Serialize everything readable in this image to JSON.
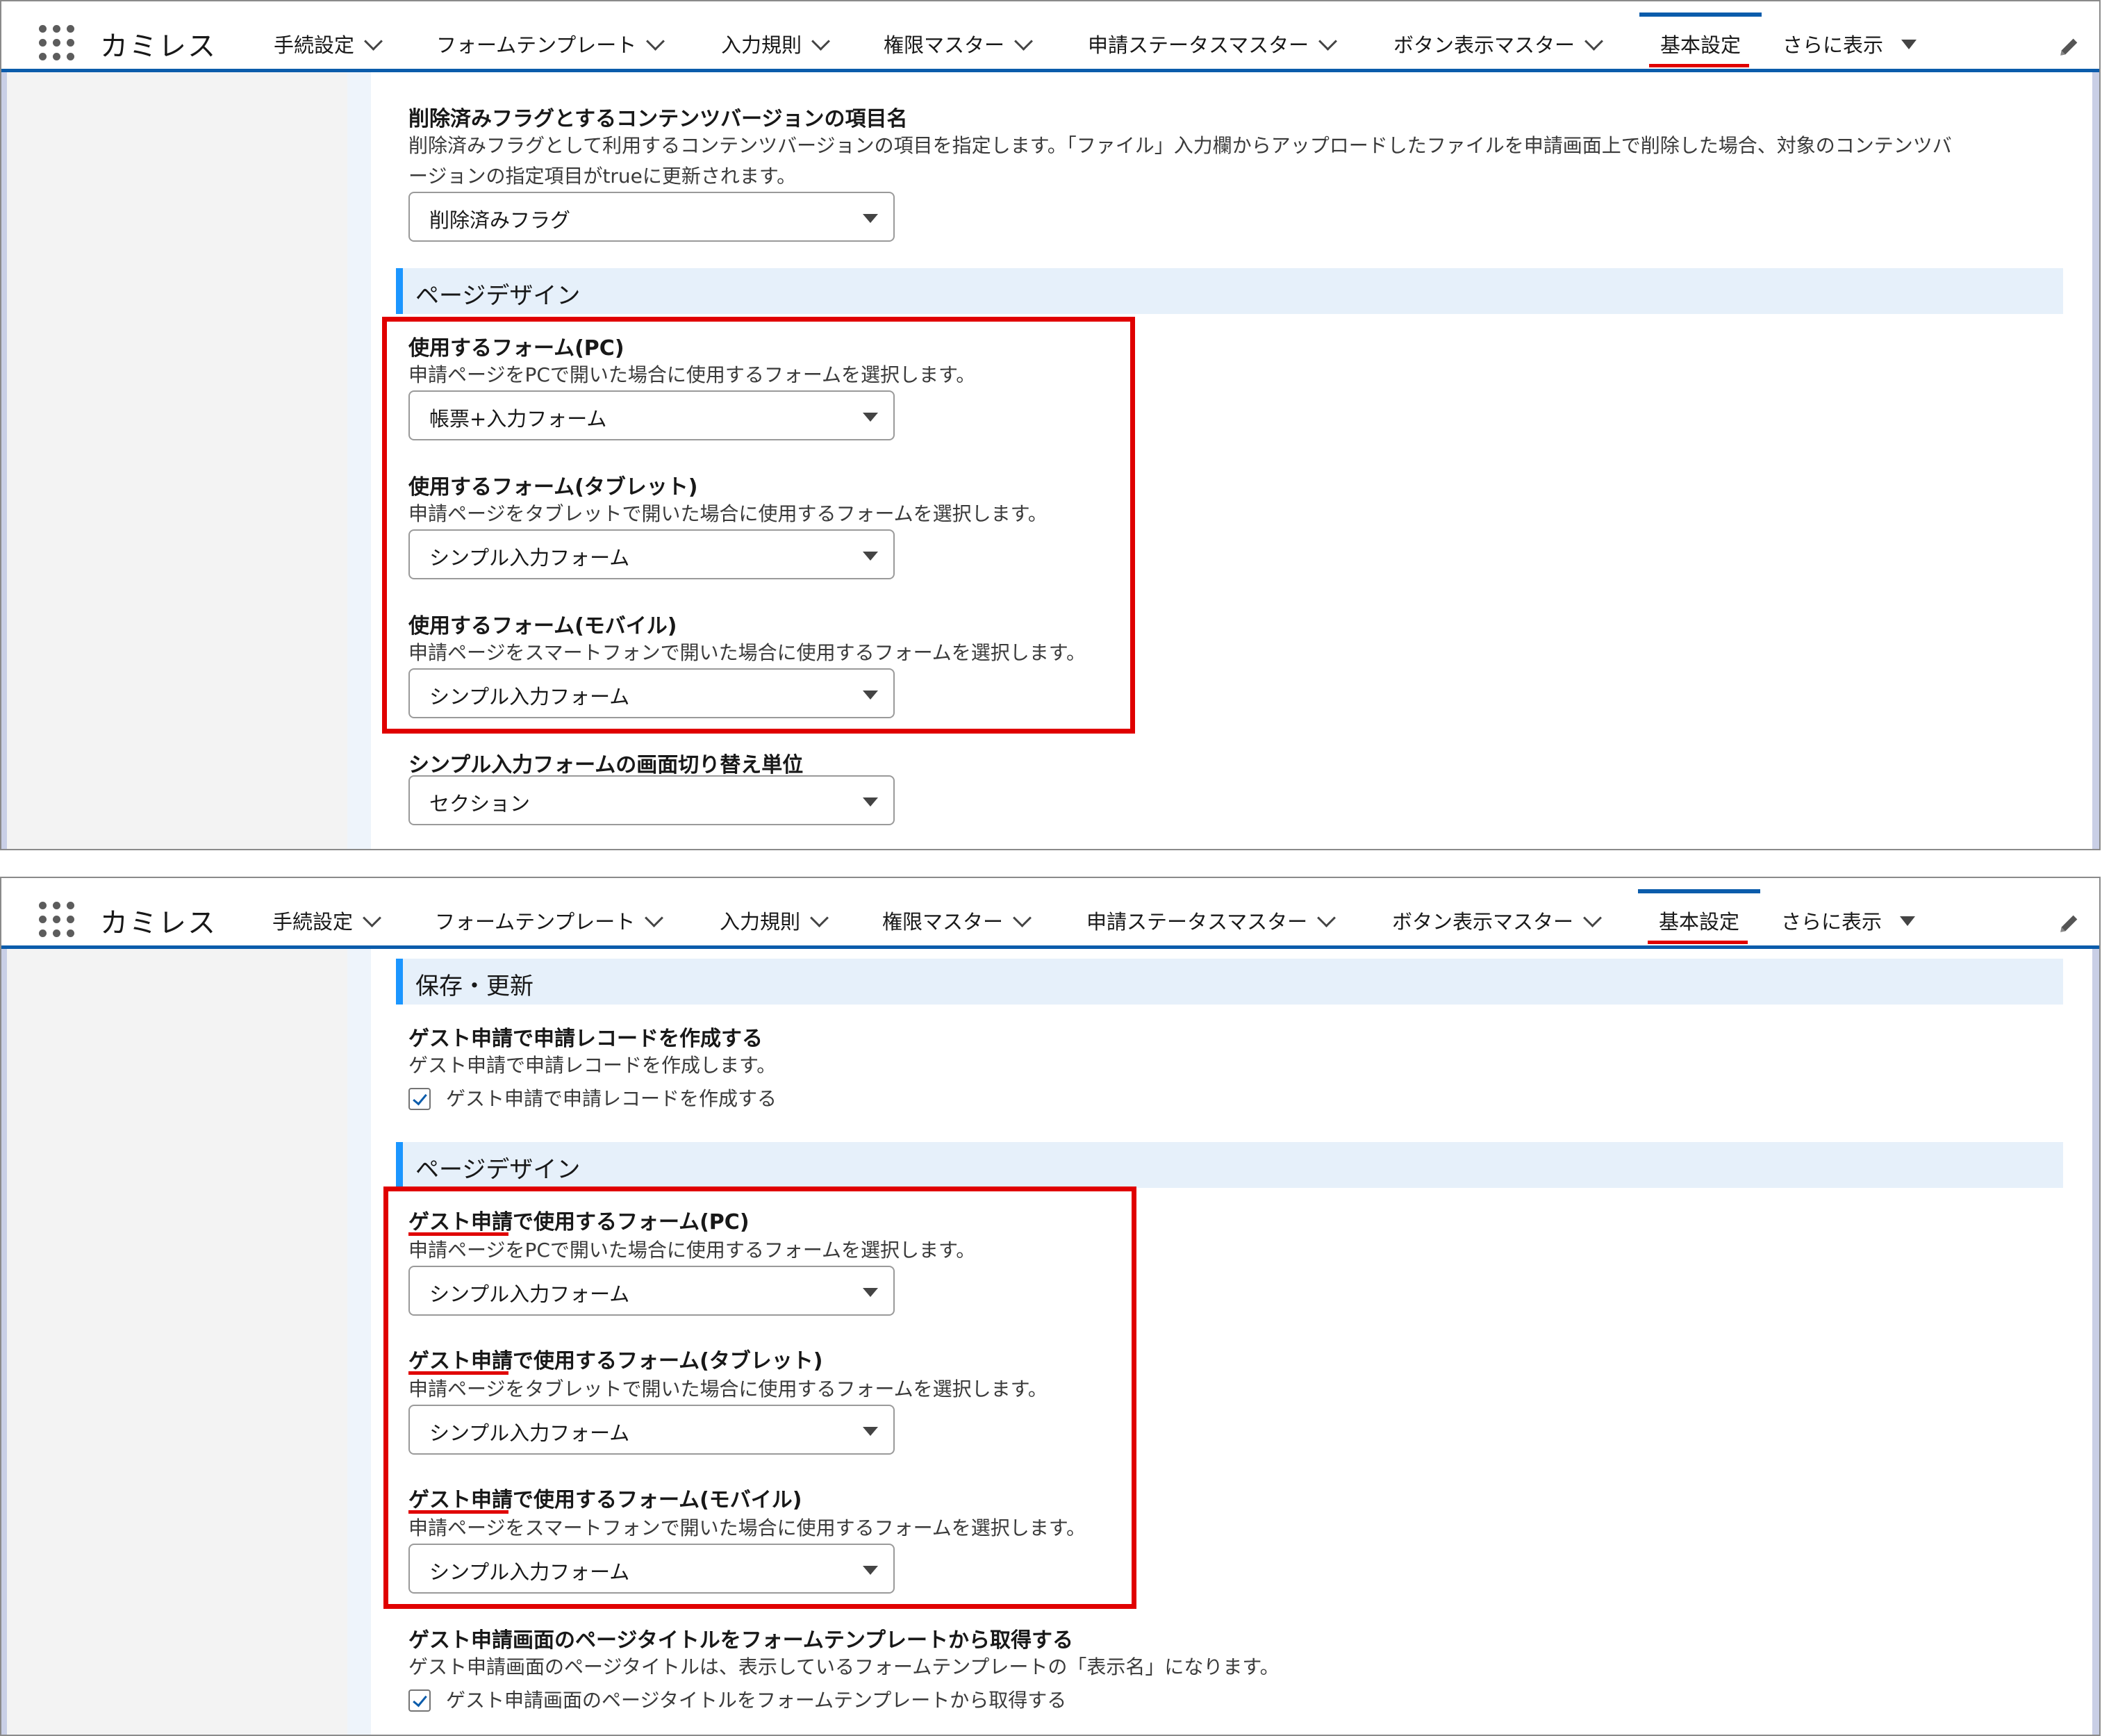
{
  "nav": {
    "app_name": "カミレス",
    "items": [
      {
        "label": "手続設定"
      },
      {
        "label": "フォームテンプレート"
      },
      {
        "label": "入力規則"
      },
      {
        "label": "権限マスター"
      },
      {
        "label": "申請ステータスマスター"
      },
      {
        "label": "ボタン表示マスター"
      },
      {
        "label": "基本設定",
        "active": true
      },
      {
        "label": "さらに表示"
      }
    ]
  },
  "top_panel": {
    "deleted_flag": {
      "label": "削除済みフラグとするコンテンツバージョンの項目名",
      "help_line1": "削除済みフラグとして利用するコンテンツバージョンの項目を指定します。「ファイル」入力欄からアップロードしたファイルを申請画面上で削除した場合、対象のコンテンツバ",
      "help_line2": "ージョンの指定項目がtrueに更新されます。",
      "value": "削除済みフラグ"
    },
    "section_title": "ページデザイン",
    "form_pc": {
      "label": "使用するフォーム(PC)",
      "help": "申請ページをPCで開いた場合に使用するフォームを選択します。",
      "value": "帳票+入力フォーム"
    },
    "form_tablet": {
      "label": "使用するフォーム(タブレット)",
      "help": "申請ページをタブレットで開いた場合に使用するフォームを選択します。",
      "value": "シンプル入力フォーム"
    },
    "form_mobile": {
      "label": "使用するフォーム(モバイル)",
      "help": "申請ページをスマートフォンで開いた場合に使用するフォームを選択します。",
      "value": "シンプル入力フォーム"
    },
    "switch_unit": {
      "label": "シンプル入力フォームの画面切り替え単位",
      "value": "セクション"
    }
  },
  "bottom_panel": {
    "save_section_title": "保存・更新",
    "guest_record": {
      "label": "ゲスト申請で申請レコードを作成する",
      "help": "ゲスト申請で申請レコードを作成します。",
      "checkbox_label": "ゲスト申請で申請レコードを作成する",
      "checked": true
    },
    "section_title": "ページデザイン",
    "guest_prefix": "ゲスト申請",
    "form_pc": {
      "label_suffix": "で使用するフォーム(PC)",
      "help": "申請ページをPCで開いた場合に使用するフォームを選択します。",
      "value": "シンプル入力フォーム"
    },
    "form_tablet": {
      "label_suffix": "で使用するフォーム(タブレット)",
      "help": "申請ページをタブレットで開いた場合に使用するフォームを選択します。",
      "value": "シンプル入力フォーム"
    },
    "form_mobile": {
      "label_suffix": "で使用するフォーム(モバイル)",
      "help": "申請ページをスマートフォンで開いた場合に使用するフォームを選択します。",
      "value": "シンプル入力フォーム"
    },
    "page_title": {
      "label": "ゲスト申請画面のページタイトルをフォームテンプレートから取得する",
      "help": "ゲスト申請画面のページタイトルは、表示しているフォームテンプレートの「表示名」になります。",
      "checkbox_label": "ゲスト申請画面のページタイトルをフォームテンプレートから取得する",
      "checked": true
    }
  },
  "icons": {
    "launcher": "app-launcher-icon",
    "edit": "pencil-icon",
    "dropdown": "chevron-down-icon",
    "check": "checkbox-icon"
  },
  "colors": {
    "brand_blue": "#0b5cab",
    "highlight_red": "#e00000",
    "section_bg": "#e6f0fa",
    "section_accent": "#1b96ff"
  }
}
